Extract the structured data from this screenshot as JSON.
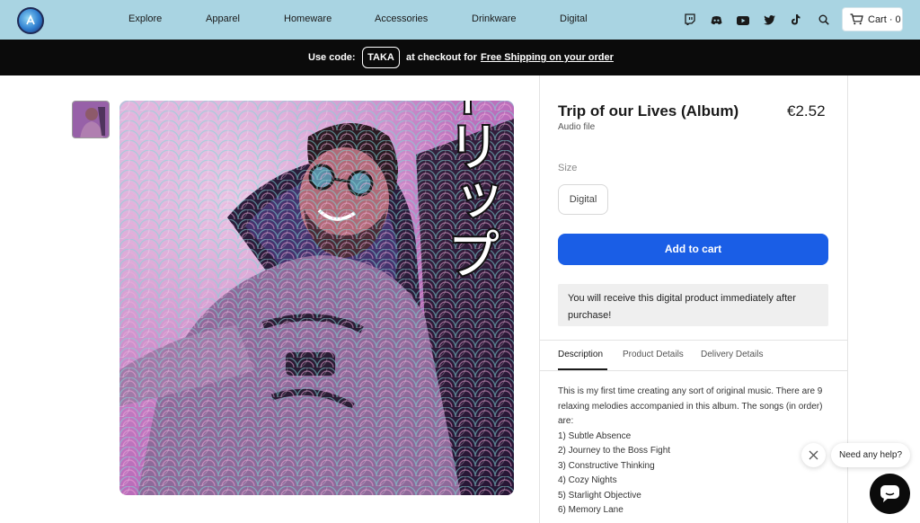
{
  "nav": {
    "links": [
      "Explore",
      "Apparel",
      "Homeware",
      "Accessories",
      "Drinkware",
      "Digital"
    ],
    "social_icons": [
      "twitch-icon",
      "discord-icon",
      "youtube-icon",
      "twitter-icon",
      "tiktok-icon",
      "search-icon"
    ],
    "cart_label": "Cart · 0"
  },
  "promo": {
    "prefix": "Use code:",
    "code": "TAKA",
    "middle": "at checkout for",
    "link": "Free Shipping on your order"
  },
  "product": {
    "title": "Trip of our Lives (Album)",
    "price": "€2.52",
    "type": "Audio file",
    "size_label": "Size",
    "size_option": "Digital",
    "add_to_cart": "Add to cart",
    "notice": "You will receive this digital product immediately after purchase!",
    "artwork_text": "トリップ"
  },
  "tabs": [
    "Description",
    "Product Details",
    "Delivery Details"
  ],
  "description": {
    "intro": "This is my first time creating any sort of original music. There are 9 relaxing melodies accompanied in this album. The songs (in order) are:",
    "songs": [
      "1) Subtle Absence",
      "2) Journey to the Boss Fight",
      "3) Constructive Thinking",
      "4) Cozy Nights",
      "5) Starlight Objective",
      "6) Memory Lane"
    ]
  },
  "chat": {
    "bubble": "Need any help?"
  },
  "colors": {
    "nav_bg": "#a9d4e2",
    "promo_bg": "#0b0b0b",
    "primary_button": "#1a5ee6",
    "notice_bg": "#efefef"
  }
}
